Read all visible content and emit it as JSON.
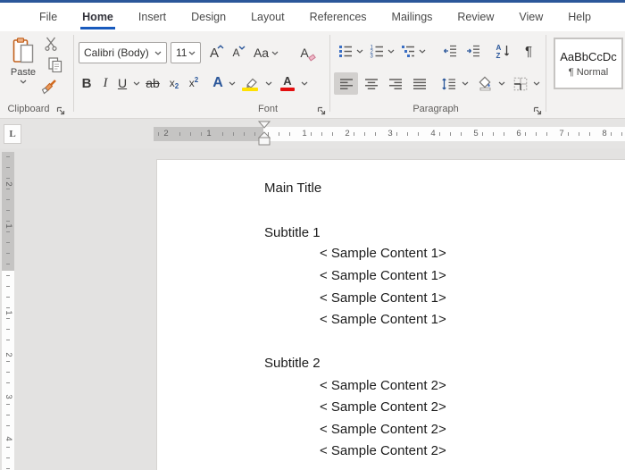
{
  "window": {
    "accent_color": "#2b579a",
    "tab_underline_color": "#185abd"
  },
  "menu": {
    "tabs": [
      "File",
      "Home",
      "Insert",
      "Design",
      "Layout",
      "References",
      "Mailings",
      "Review",
      "View",
      "Help"
    ],
    "active_tab": "Home"
  },
  "ribbon": {
    "clipboard": {
      "group_label": "Clipboard",
      "paste_label": "Paste"
    },
    "font": {
      "group_label": "Font",
      "font_name": "Calibri (Body)",
      "font_size": "11",
      "bold": "B",
      "italic": "I",
      "underline": "U",
      "strikethrough": "ab",
      "subscript_base": "x",
      "subscript_mark": "2",
      "superscript_base": "x",
      "superscript_mark": "2",
      "grow_letter": "A",
      "shrink_letter": "A",
      "change_case": "Aa",
      "clear_letter": "A",
      "effects_letter": "A",
      "font_color_letter": "A",
      "highlight_color": "#ffe100",
      "font_color": "#e30f0f"
    },
    "paragraph": {
      "group_label": "Paragraph",
      "pilcrow": "¶",
      "sort_a": "A",
      "sort_z": "Z"
    },
    "styles": {
      "preview_text": "AaBbCcDc",
      "style_name": "¶ Normal"
    }
  },
  "ruler": {
    "tab_selector": "L",
    "horizontal": {
      "margin_numbers": [
        "2",
        "1"
      ],
      "page_numbers": [
        "1",
        "2",
        "3",
        "4",
        "5",
        "6",
        "7",
        "8"
      ]
    },
    "vertical": {
      "margin_numbers": [
        "2",
        "1"
      ],
      "page_numbers": [
        "1",
        "2",
        "3",
        "4"
      ]
    }
  },
  "document": {
    "title": "Main Title",
    "sections": [
      {
        "heading": "Subtitle 1",
        "items": [
          "< Sample Content 1>",
          "< Sample Content 1>",
          "< Sample Content 1>",
          "< Sample Content 1>"
        ]
      },
      {
        "heading": "Subtitle 2",
        "items": [
          "< Sample Content 2>",
          "< Sample Content 2>",
          "< Sample Content 2>",
          "< Sample Content 2>"
        ]
      }
    ]
  }
}
